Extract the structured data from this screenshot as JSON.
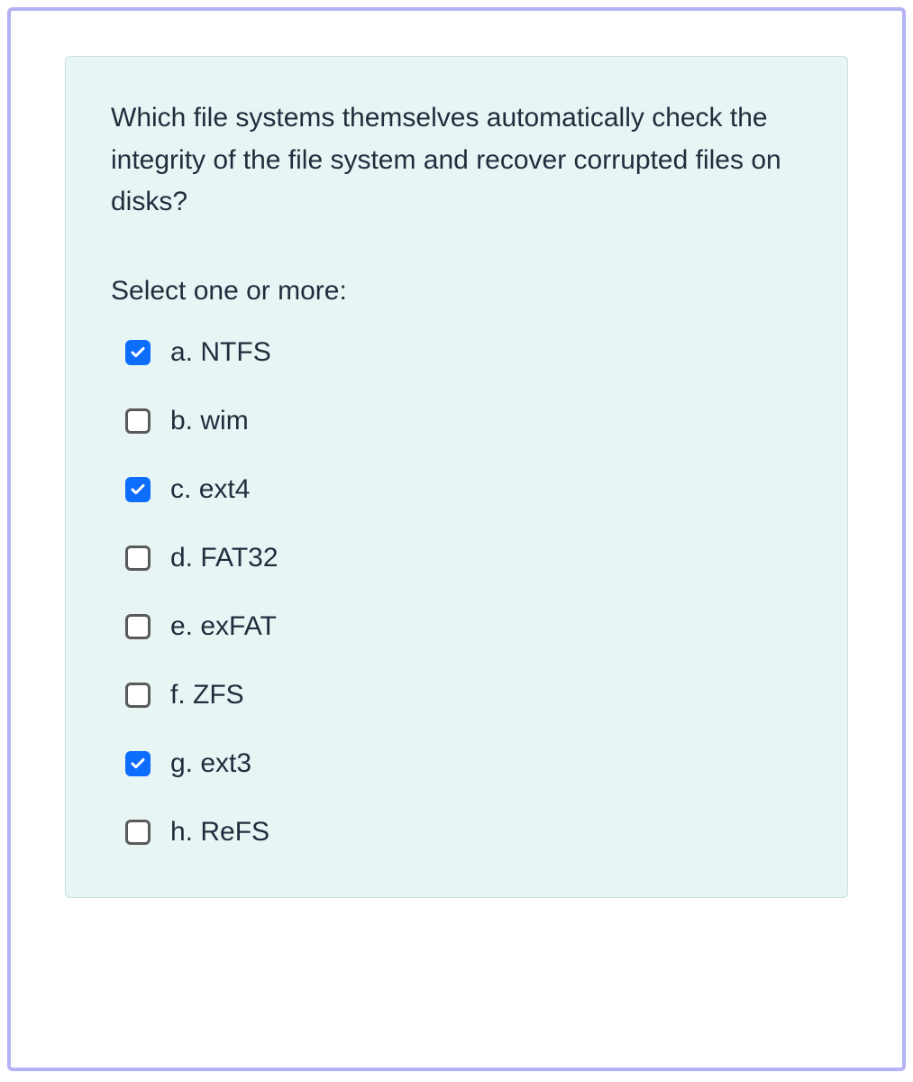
{
  "question": {
    "text": "Which file systems themselves automatically check the integrity of the file system and recover corrupted files on disks?",
    "instruction": "Select one or more:",
    "options": [
      {
        "letter": "a.",
        "label": "NTFS",
        "checked": true
      },
      {
        "letter": "b.",
        "label": "wim",
        "checked": false
      },
      {
        "letter": "c.",
        "label": "ext4",
        "checked": true
      },
      {
        "letter": "d.",
        "label": "FAT32",
        "checked": false
      },
      {
        "letter": "e.",
        "label": "exFAT",
        "checked": false
      },
      {
        "letter": "f.",
        "label": "ZFS",
        "checked": false
      },
      {
        "letter": "g.",
        "label": "ext3",
        "checked": true
      },
      {
        "letter": "h.",
        "label": "ReFS",
        "checked": false
      }
    ]
  },
  "colors": {
    "card_bg": "#e8f5f5",
    "accent": "#0d6efd",
    "border": "#b3b3f5"
  }
}
